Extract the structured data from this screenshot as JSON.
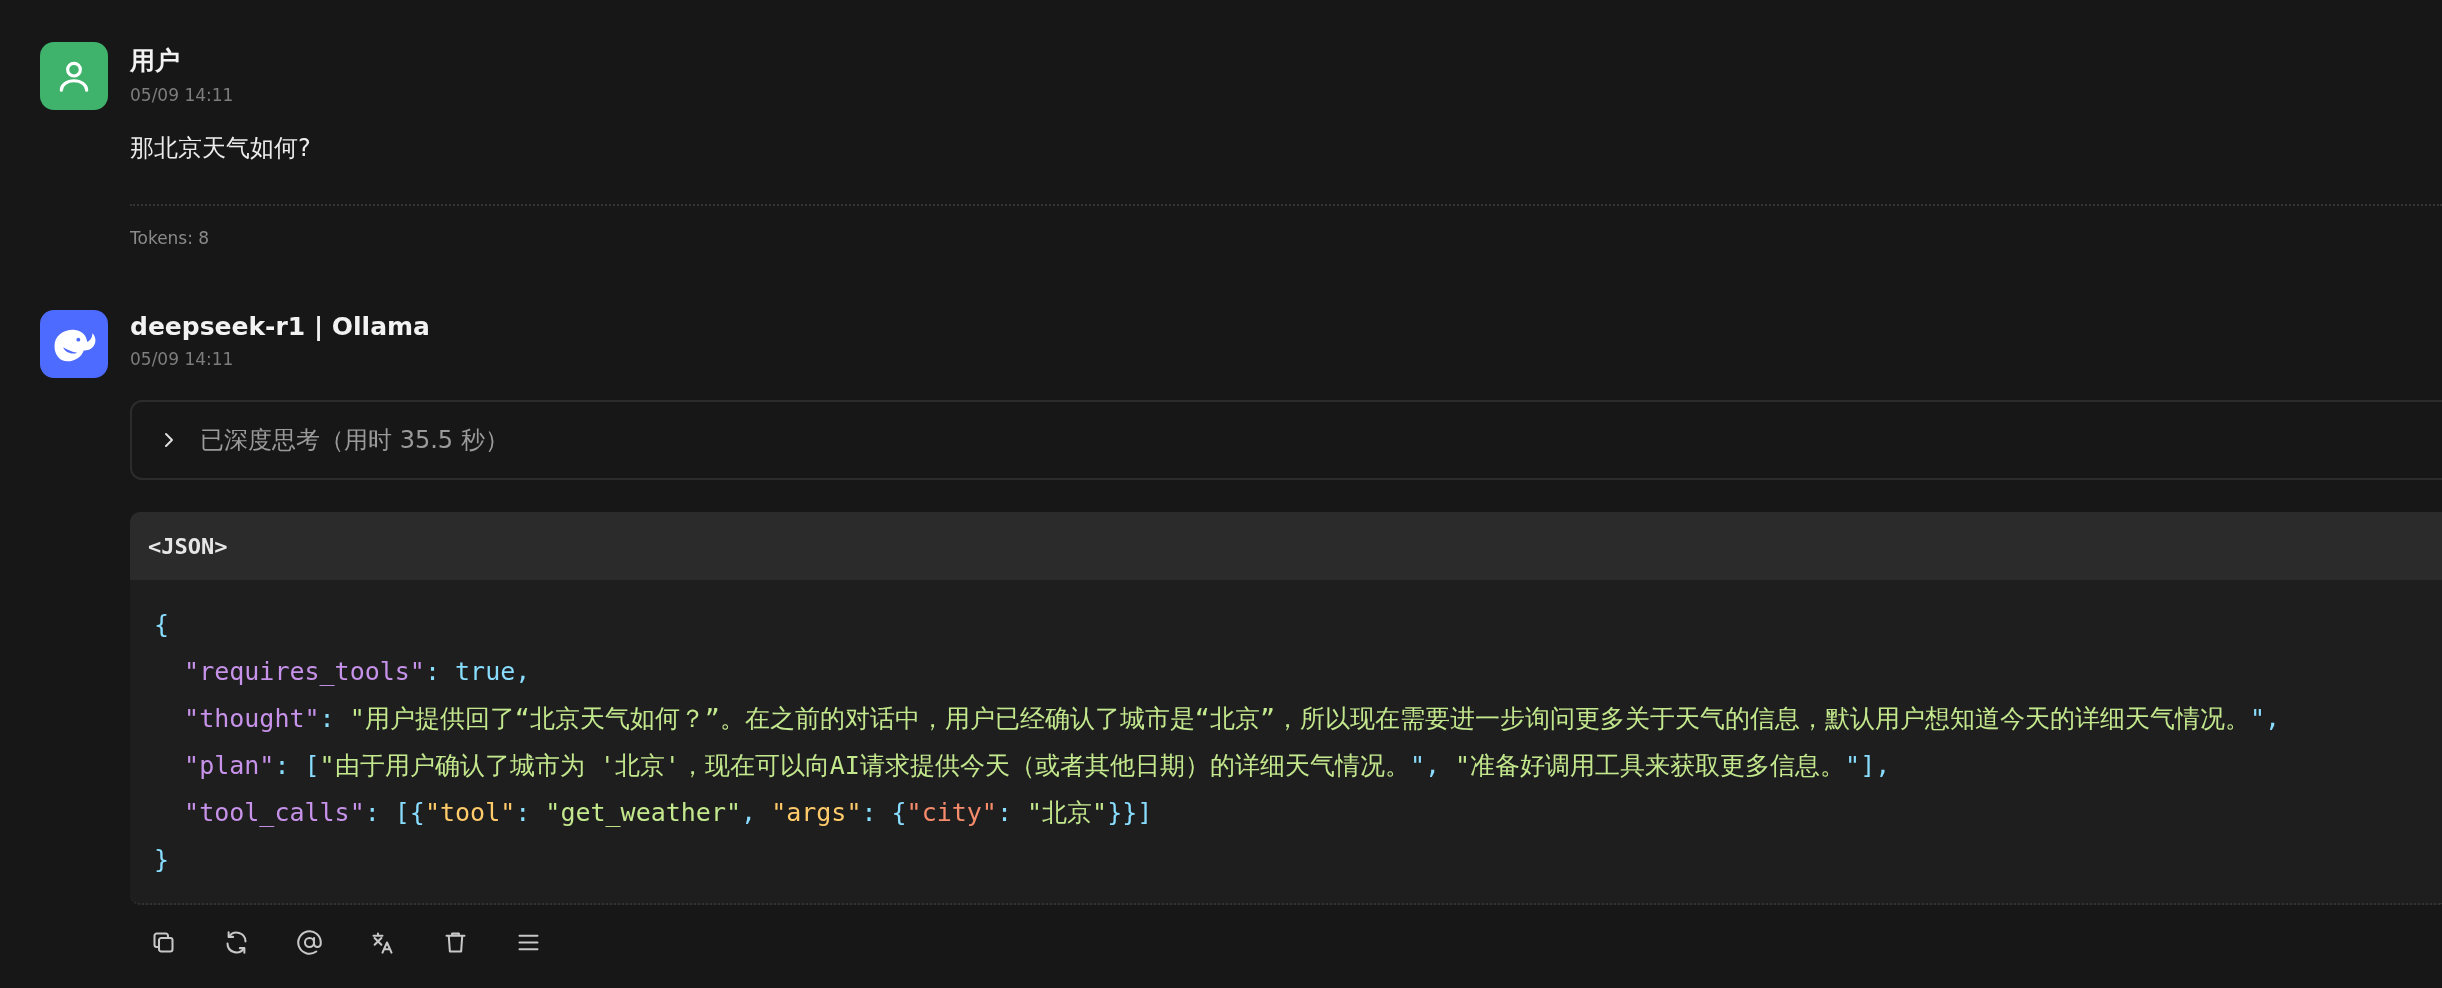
{
  "messages": [
    {
      "kind": "user",
      "author": "用户",
      "time": "05/09 14:11",
      "text": "那北京天气如何?",
      "footer": "Tokens: 8"
    },
    {
      "kind": "assistant",
      "author": "deepseek-r1 | Ollama",
      "time": "05/09 14:11",
      "thinking": {
        "label": "已深度思考（用时 35.5 秒）",
        "expanded": false
      },
      "code_block": {
        "language": "<JSON>",
        "lines": [
          {
            "tokens": [
              {
                "t": "{",
                "kind": "punct"
              }
            ]
          },
          {
            "tokens": [
              {
                "t": "  \"requires_tools\"",
                "kind": "key"
              },
              {
                "t": ": ",
                "kind": "punct"
              },
              {
                "t": "true",
                "kind": "bool"
              },
              {
                "t": ",",
                "kind": "punct"
              }
            ]
          },
          {
            "tokens": [
              {
                "t": "  \"thought\"",
                "kind": "key"
              },
              {
                "t": ": ",
                "kind": "punct"
              },
              {
                "t": "\"用户提供回了“北京天气如何？”。在之前的对话中，用户已经确认了城市是“北京”，所以现在需要进一步询问更多关于天气的信息，默认用户想知道今天的详细天气情况。",
                "kind": "string"
              },
              {
                "t": "\",",
                "kind": "punct"
              }
            ]
          },
          {
            "tokens": [
              {
                "t": "  \"plan\"",
                "kind": "key"
              },
              {
                "t": ": [",
                "kind": "punct"
              },
              {
                "t": "\"由于用户确认了城市为 '北京'，现在可以向AI请求提供今天（或者其他日期）的详细天气情况。",
                "kind": "string"
              },
              {
                "t": "\", ",
                "kind": "punct"
              },
              {
                "t": "\"准备好调用工具来获取更多信息。",
                "kind": "string"
              },
              {
                "t": "\"],",
                "kind": "punct"
              }
            ]
          },
          {
            "tokens": [
              {
                "t": "  \"tool_calls\"",
                "kind": "key"
              },
              {
                "t": ": [{",
                "kind": "punct"
              },
              {
                "t": "\"tool\"",
                "kind": "key2"
              },
              {
                "t": ": ",
                "kind": "punct"
              },
              {
                "t": "\"get_weather\"",
                "kind": "string"
              },
              {
                "t": ", ",
                "kind": "punct"
              },
              {
                "t": "\"args\"",
                "kind": "key2"
              },
              {
                "t": ": {",
                "kind": "punct"
              },
              {
                "t": "\"city\"",
                "kind": "key3"
              },
              {
                "t": ": ",
                "kind": "punct"
              },
              {
                "t": "\"北京\"",
                "kind": "string"
              },
              {
                "t": "}}]",
                "kind": "punct"
              }
            ]
          },
          {
            "tokens": [
              {
                "t": "}",
                "kind": "punct"
              }
            ]
          }
        ]
      },
      "actions": [
        {
          "kind": "copy"
        },
        {
          "kind": "refresh"
        },
        {
          "kind": "mention"
        },
        {
          "kind": "translate"
        },
        {
          "kind": "delete"
        },
        {
          "kind": "menu"
        }
      ]
    }
  ]
}
